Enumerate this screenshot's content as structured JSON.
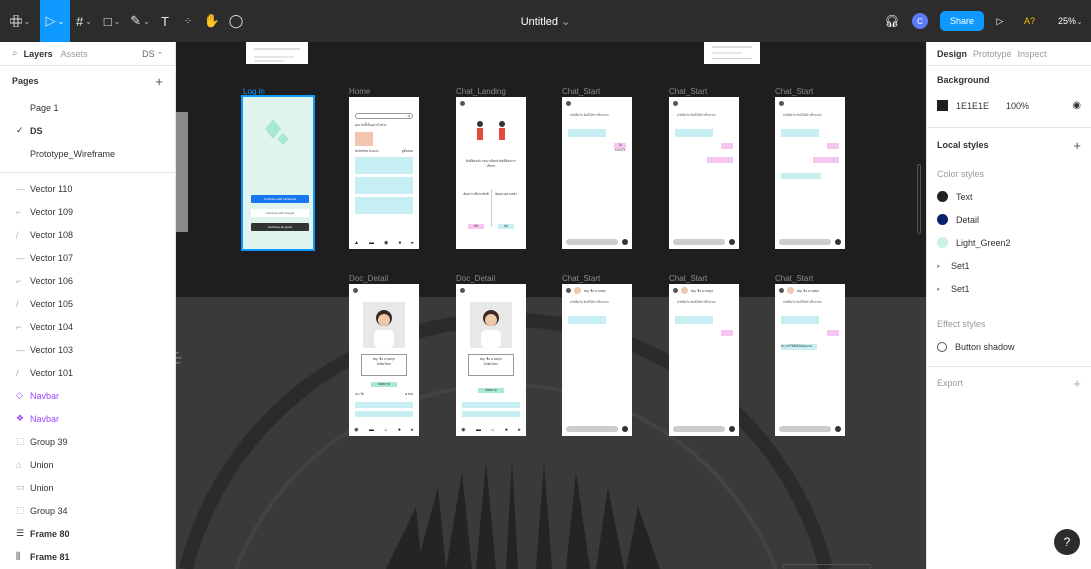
{
  "toolbar": {
    "main_menu_icon": "figma-logo-icon",
    "move_icon": "move-tool-icon",
    "frame_icon": "frame-tool-icon",
    "shape_icon": "rectangle-tool-icon",
    "pen_icon": "pen-tool-icon",
    "text_glyph": "T",
    "resources_icon": "resources-icon",
    "hand_icon": "hand-tool-icon",
    "comment_icon": "comment-tool-icon",
    "file_title": "Untitled",
    "title_chevron": "⌄",
    "avatar_initial": "C",
    "share_label": "Share",
    "ai_label": "A?",
    "zoom": "25%"
  },
  "left_panel": {
    "tab_layers": "Layers",
    "tab_assets": "Assets",
    "page_switch": "DS",
    "pages_header": "Pages",
    "add_page": "+",
    "pages": [
      {
        "label": "Page 1",
        "current": false
      },
      {
        "label": "DS",
        "current": true
      },
      {
        "label": "Prototype_Wireframe",
        "current": false
      }
    ],
    "layers": [
      {
        "label": "Vector 110",
        "icon": "—"
      },
      {
        "label": "Vector 109",
        "icon": "⌐"
      },
      {
        "label": "Vector 108",
        "icon": "/"
      },
      {
        "label": "Vector 107",
        "icon": "—"
      },
      {
        "label": "Vector 106",
        "icon": "⌐"
      },
      {
        "label": "Vector 105",
        "icon": "/"
      },
      {
        "label": "Vector 104",
        "icon": "⌐"
      },
      {
        "label": "Vector 103",
        "icon": "—"
      },
      {
        "label": "Vector 101",
        "icon": "/"
      },
      {
        "label": "Navbar",
        "icon": "◇"
      },
      {
        "label": "Navbar",
        "icon": "❖"
      },
      {
        "label": "Group 39",
        "icon": "⬚"
      },
      {
        "label": "Union",
        "icon": "⌂"
      },
      {
        "label": "Union",
        "icon": "▭"
      },
      {
        "label": "Group 34",
        "icon": "⬚"
      },
      {
        "label": "Frame 80",
        "icon": "☰"
      },
      {
        "label": "Frame 81",
        "icon": "⫼"
      }
    ]
  },
  "canvas": {
    "frames_row1": [
      {
        "label": "Log in"
      },
      {
        "label": "Home"
      },
      {
        "label": "Chat_Landing"
      },
      {
        "label": "Chat_Start"
      },
      {
        "label": "Chat_Start"
      },
      {
        "label": "Chat_Start"
      }
    ],
    "frames_row2": [
      {
        "label": "Doc_Detail"
      },
      {
        "label": "Doc_Detail"
      },
      {
        "label": "Chat_Start"
      },
      {
        "label": "Chat_Start"
      },
      {
        "label": "Chat_Start"
      }
    ],
    "login": {
      "facebook": "Continue with Facebook",
      "google": "Continue with Google",
      "guest": "Continue as guest"
    },
    "home": {
      "search_placeholder": "Q",
      "greeting": "คุณ  วันนี้เป็นอย่างไรบ้าง",
      "section": "นักจิตวิทยาแนะนำ",
      "see_all": "ดูทั้งหมด",
      "doctor_name": "พญ. ชื่อ นามสกุล",
      "cta": "ปรึกษาเลย"
    },
    "chat_landing": {
      "prompt": "ยินดีต้อนรับ กรุณาเลือกหัวข้อที่ต้องการปรึกษา",
      "left_option": "ต้องการปรึกษาทันที",
      "right_option": "นัดหมายล่วงหน้า",
      "left_btn": "เริ่ม",
      "right_btn": "นัด"
    },
    "chat_start": {
      "bot_msg": "สวัสดีครับ ยินดีให้คำปรึกษาค่ะ",
      "user_msg": "ไม่สบายใจ",
      "doctor_name": "พญ. ชื่อ นามสกุล",
      "reply": "ค่ะ เล่าให้ฟังได้เลยนะคะ"
    },
    "doc_detail": {
      "name": "พญ. ชื่อ นามสกุล",
      "role": "นักจิตวิทยา",
      "btn": "นัดหมาย",
      "price": "฿ 500",
      "section": "ประวัติ"
    }
  },
  "right_panel": {
    "tab_design": "Design",
    "tab_prototype": "Prototype",
    "tab_inspect": "Inspect",
    "background_title": "Background",
    "background_hex": "1E1E1E",
    "background_opacity": "100%",
    "background_color": "#1e1e1e",
    "local_styles_title": "Local styles",
    "add_style": "+",
    "color_styles_title": "Color styles",
    "color_styles": [
      {
        "label": "Text",
        "color": "#222222"
      },
      {
        "label": "Detail",
        "color": "#0b1f6b"
      },
      {
        "label": "Light_Green2",
        "color": "#ccefe8"
      }
    ],
    "sets": [
      "Set1",
      "Set1"
    ],
    "effect_styles_title": "Effect styles",
    "effect_style": "Button shadow",
    "export_title": "Export",
    "add_export": "+",
    "help": "?"
  }
}
